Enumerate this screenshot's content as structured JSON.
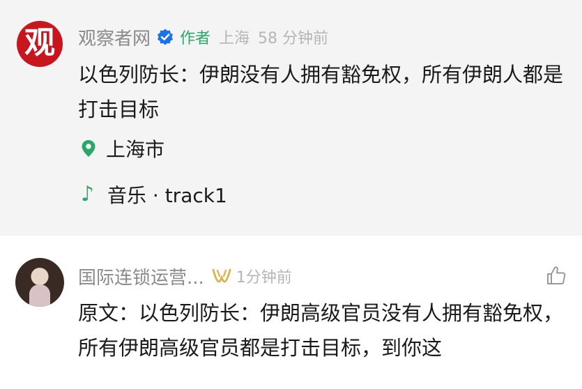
{
  "post": {
    "avatar_logo_text": "观",
    "author": "观察者网",
    "author_tag": "作者",
    "location_meta": "上海",
    "time": "58 分钟前",
    "body": "以色列防长：伊朗没有人拥有豁免权，所有伊朗人都是打击目标",
    "location_label": "上海市",
    "music_label": "音乐 · track1",
    "icons": {
      "verified": "verified-badge-icon",
      "location": "map-pin-icon",
      "music": "music-note-icon"
    }
  },
  "comment": {
    "commenter": "国际连锁运营...",
    "time": "1分钟前",
    "body": "原文：以色列防长：伊朗高级官员没有人拥有豁免权，所有伊朗高级官员都是打击目标，到你这",
    "icons": {
      "badge": "gold-badge-icon",
      "like": "thumbs-up-icon"
    }
  },
  "colors": {
    "accent_green": "#2aa86b",
    "verified_blue": "#1a73e8",
    "avatar_red": "#c8161e",
    "badge_gold": "#d9b44a",
    "meta_gray": "#b5b5b5"
  }
}
